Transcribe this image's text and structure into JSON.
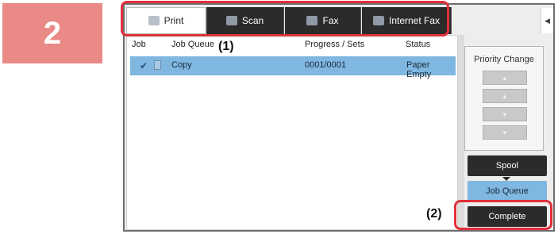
{
  "step_number": "2",
  "tabs": [
    {
      "label": "Print",
      "icon": "printer-icon",
      "active": true
    },
    {
      "label": "Scan",
      "icon": "scan-icon",
      "active": false
    },
    {
      "label": "Fax",
      "icon": "fax-icon",
      "active": false
    },
    {
      "label": "Internet Fax",
      "icon": "internet-fax-icon",
      "active": false
    }
  ],
  "side_arrow": "◀",
  "list": {
    "headers": {
      "job": "Job",
      "job_queue": "Job Queue",
      "progress": "Progress / Sets",
      "status": "Status"
    },
    "rows": [
      {
        "check": "✔",
        "name": "Copy",
        "progress": "0001/0001",
        "status": "Paper Empty",
        "selected": true
      }
    ]
  },
  "priority": {
    "title": "Priority Change",
    "buttons": [
      "▲",
      "▲",
      "▼",
      "▼"
    ]
  },
  "buttons": {
    "spool": "Spool",
    "job_queue": "Job Queue",
    "complete": "Complete"
  },
  "callouts": {
    "tabs": "(1)",
    "complete": "(2)"
  },
  "colors": {
    "step_badge": "#ea8a86",
    "callout": "#e0303a",
    "selected_row": "#7fb7e0",
    "dark_button": "#2b2b2b"
  }
}
